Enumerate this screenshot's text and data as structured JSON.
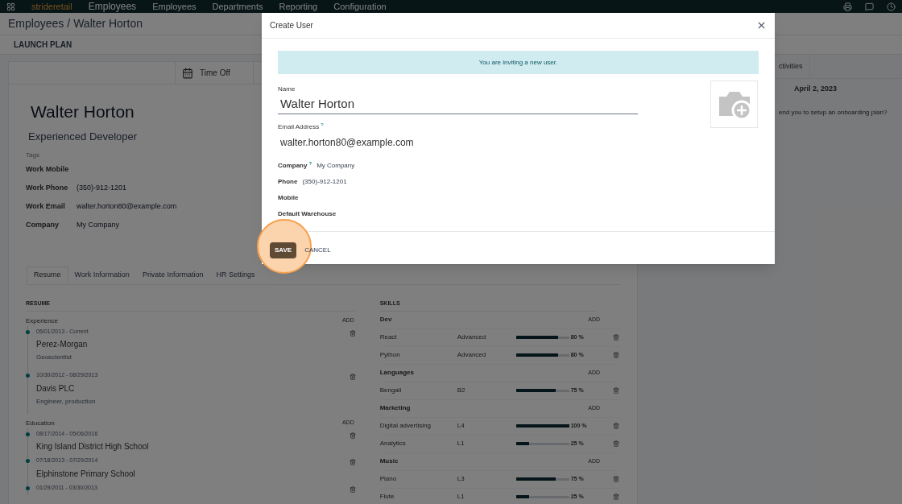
{
  "navbar": {
    "logo": "strideretail",
    "app": "Employees",
    "menu": [
      "Employees",
      "Departments",
      "Reporting",
      "Configuration"
    ]
  },
  "breadcrumb": {
    "parent": "Employees",
    "separator": "/",
    "current": "Walter Horton"
  },
  "control_panel": {
    "action": "LAUNCH PLAN"
  },
  "smart_buttons": [
    {
      "label": "Time Off"
    }
  ],
  "employee": {
    "name": "Walter Horton",
    "job_title": "Experienced Developer",
    "tags_label": "Tags",
    "fields": [
      {
        "label": "Work Mobile"
      },
      {
        "label": "Work Phone",
        "value": "(350)-912-1201"
      },
      {
        "label": "Work Email",
        "value": "walter.horton80@example.com"
      },
      {
        "label": "Company",
        "value": "My Company"
      }
    ]
  },
  "tabs": [
    {
      "label": "Resume",
      "selected": true
    },
    {
      "label": "Work Information",
      "selected": false
    },
    {
      "label": "Private Information",
      "selected": false
    },
    {
      "label": "HR Settings",
      "selected": false
    }
  ],
  "resume": {
    "title": "RESUME",
    "sections": [
      {
        "name": "Experience",
        "add": "ADD",
        "items": [
          {
            "dates": "05/01/2013 - Current",
            "title": "Perez-Morgan",
            "subtitle": "Geoscientist"
          },
          {
            "dates": "10/30/2012 - 08/29/2013",
            "title": "Davis PLC",
            "subtitle": "Engineer, production"
          }
        ]
      },
      {
        "name": "Education",
        "add": "ADD",
        "items": [
          {
            "dates": "08/17/2014 - 05/06/2016",
            "title": "King Island District High School"
          },
          {
            "dates": "07/18/2013 - 07/29/2014",
            "title": "Elphinstone Primary School"
          },
          {
            "dates": "01/29/2011 - 03/30/2013"
          }
        ]
      }
    ]
  },
  "skills": {
    "title": "SKILLS",
    "groups": [
      {
        "name": "Dev",
        "add": "ADD",
        "rows": [
          {
            "name": "React",
            "level_name": "Advanced",
            "level": 0.8,
            "reading": "80 %"
          },
          {
            "name": "Python",
            "level_name": "Advanced",
            "level": 0.8,
            "reading": "80 %"
          }
        ]
      },
      {
        "name": "Languages",
        "add": "ADD",
        "rows": [
          {
            "name": "Bengali",
            "level_name": "B2",
            "level": 0.75,
            "reading": "75 %"
          }
        ]
      },
      {
        "name": "Marketing",
        "add": "ADD",
        "rows": [
          {
            "name": "Digital advertising",
            "level_name": "L4",
            "level": 1,
            "reading": "100 %"
          },
          {
            "name": "Analytics",
            "level_name": "L1",
            "level": 0.25,
            "reading": "25 %"
          }
        ]
      },
      {
        "name": "Music",
        "add": "ADD",
        "rows": [
          {
            "name": "Piano",
            "level_name": "L3",
            "level": 0.75,
            "reading": "75 %"
          },
          {
            "name": "Flute",
            "level_name": "L1",
            "level": 0.25,
            "reading": "25 %"
          }
        ]
      }
    ]
  },
  "chatter": {
    "tab": "ctivities",
    "date": "April 2, 2023",
    "message": "end you to setup an onboarding plan?"
  },
  "dialog": {
    "title": "Create User",
    "notice": "You are inviting a new user.",
    "name_label": "Name",
    "name_value": "Walter Horton",
    "email_label": "Email Address",
    "email_help": "?",
    "email_value": "walter.horton80@example.com",
    "fields": [
      {
        "label": "Company",
        "help": "?",
        "value": "My Company"
      },
      {
        "label": "Phone",
        "value": "(350)-912-1201"
      },
      {
        "label": "Mobile"
      },
      {
        "label": "Default Warehouse"
      }
    ],
    "buttons": [
      {
        "label": "SAVE",
        "kind": "primary",
        "highlighted": true
      },
      {
        "label": "CANCEL",
        "kind": "secondary",
        "highlighted": false
      }
    ]
  }
}
